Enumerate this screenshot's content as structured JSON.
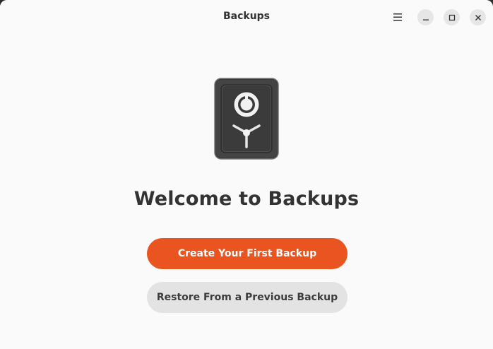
{
  "window": {
    "title": "Backups"
  },
  "header": {
    "menu_icon": "hamburger-menu-icon",
    "minimize_icon": "minimize-icon",
    "maximize_icon": "maximize-icon",
    "close_icon": "close-icon"
  },
  "main": {
    "icon": "safe-vault-icon",
    "welcome_title": "Welcome to Backups",
    "primary_button_label": "Create Your First Backup",
    "secondary_button_label": "Restore From a Previous Backup"
  },
  "colors": {
    "accent": "#e95420",
    "background": "#fafafa",
    "secondary_button": "#e3e3e3",
    "title_text": "#333333"
  }
}
